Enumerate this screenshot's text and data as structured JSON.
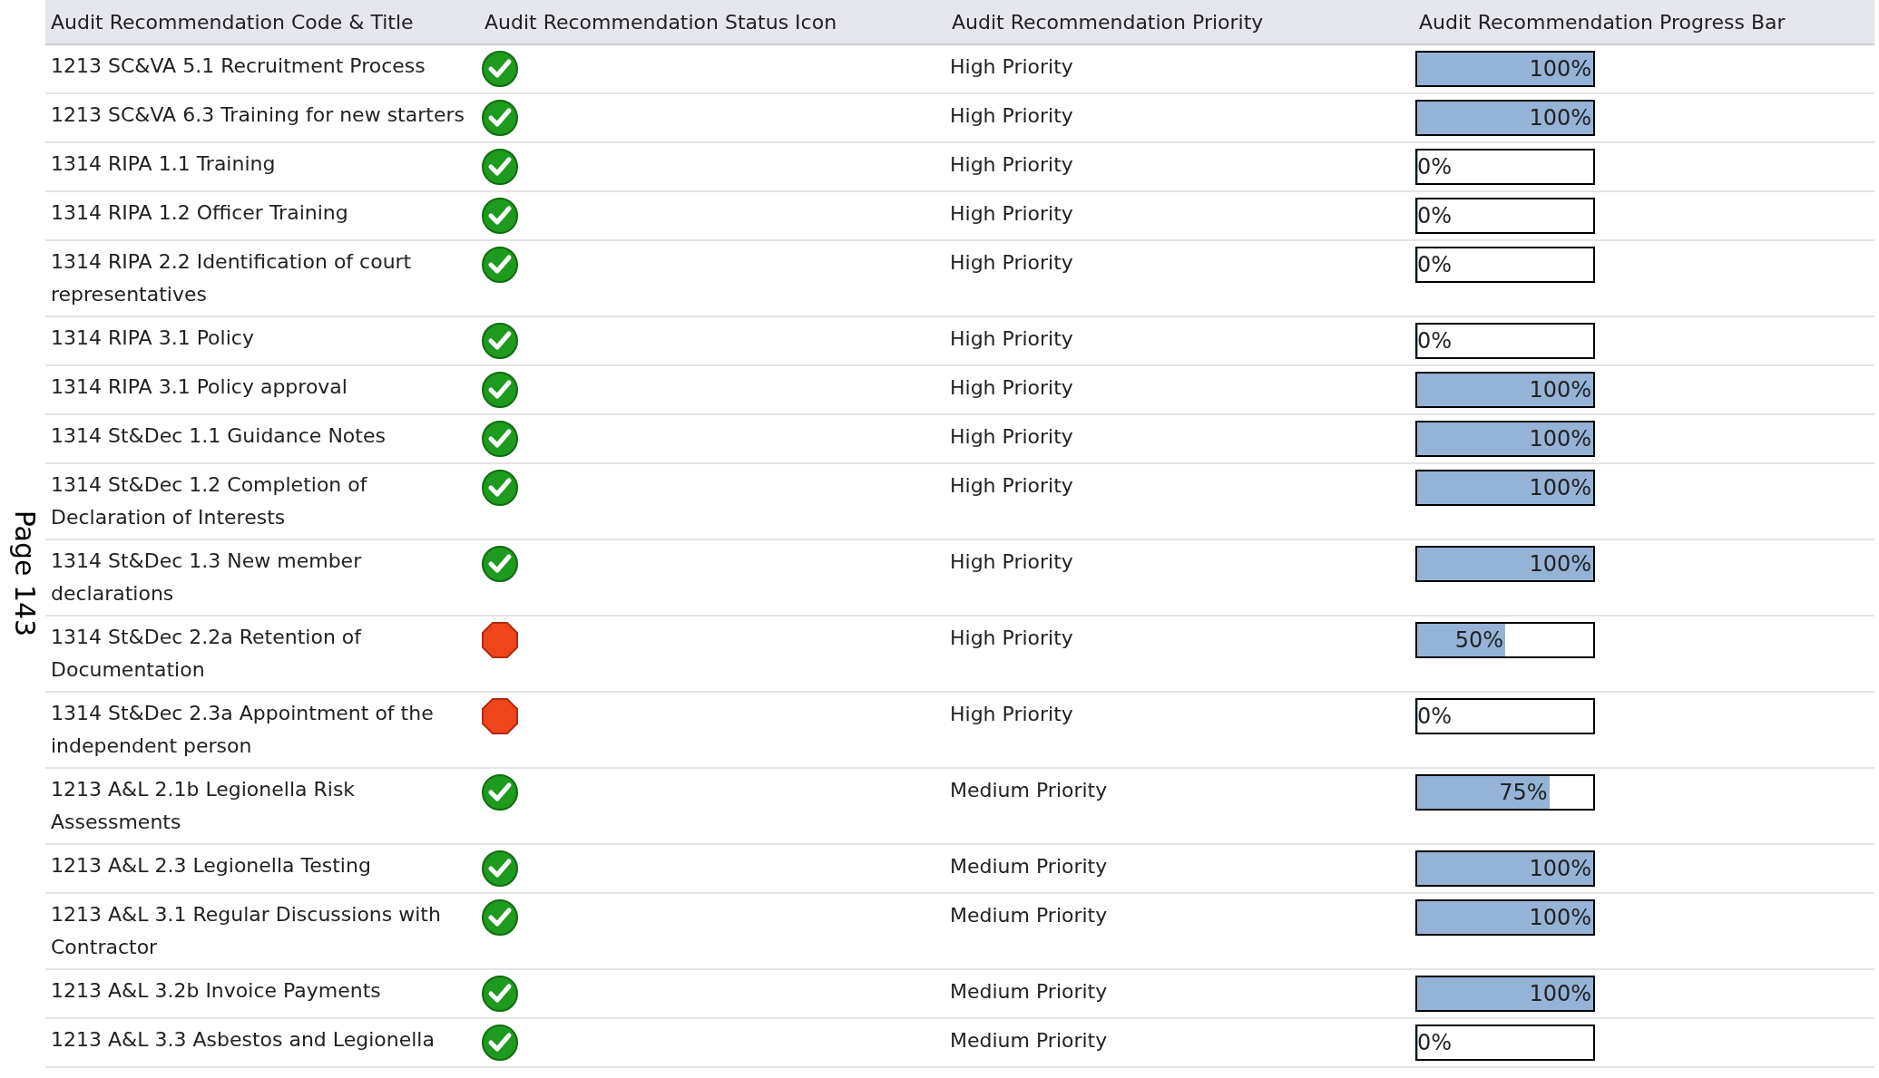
{
  "page_label": "Page 143",
  "table": {
    "columns": [
      "Audit Recommendation Code & Title",
      "Audit Recommendation Status Icon",
      "Audit Recommendation Priority",
      "Audit Recommendation Progress Bar"
    ],
    "rows": [
      {
        "title": "1213 SC&VA 5.1 Recruitment Process",
        "kind": "complete",
        "priority": "High Priority",
        "level": 1,
        "progress": "100%"
      },
      {
        "title": "1213 SC&VA 6.3 Training for new starters",
        "kind": "complete",
        "priority": "High Priority",
        "level": 1,
        "progress": "100%"
      },
      {
        "title": "1314 RIPA 1.1 Training",
        "kind": "complete",
        "priority": "High Priority",
        "level": 0,
        "progress": "0%"
      },
      {
        "title": "1314 RIPA 1.2 Officer Training",
        "kind": "complete",
        "priority": "High Priority",
        "level": 0,
        "progress": "0%"
      },
      {
        "title": "1314 RIPA 2.2 Identification of court representatives",
        "kind": "complete",
        "priority": "High Priority",
        "level": 0,
        "progress": "0%"
      },
      {
        "title": "1314 RIPA 3.1 Policy",
        "kind": "complete",
        "priority": "High Priority",
        "level": 0,
        "progress": "0%"
      },
      {
        "title": "1314 RIPA 3.1 Policy approval",
        "kind": "complete",
        "priority": "High Priority",
        "level": 1,
        "progress": "100%"
      },
      {
        "title": "1314 St&Dec 1.1 Guidance Notes",
        "kind": "complete",
        "priority": "High Priority",
        "level": 1,
        "progress": "100%"
      },
      {
        "title": "1314 St&Dec 1.2 Completion of Declaration of Interests",
        "kind": "complete",
        "priority": "High Priority",
        "level": 1,
        "progress": "100%"
      },
      {
        "title": "1314 St&Dec 1.3 New member declarations",
        "kind": "complete",
        "priority": "High Priority",
        "level": 1,
        "progress": "100%"
      },
      {
        "title": "1314 St&Dec 2.2a Retention of Documentation",
        "kind": "stopped",
        "priority": "High Priority",
        "level": 0.5,
        "progress": "50%"
      },
      {
        "title": "1314 St&Dec 2.3a Appointment of the independent person",
        "kind": "stopped",
        "priority": "High Priority",
        "level": 0,
        "progress": "0%"
      },
      {
        "title": "1213 A&L 2.1b Legionella Risk Assessments",
        "kind": "complete",
        "priority": "Medium Priority",
        "level": 0.75,
        "progress": "75%"
      },
      {
        "title": "1213 A&L 2.3 Legionella Testing",
        "kind": "complete",
        "priority": "Medium Priority",
        "level": 1,
        "progress": "100%"
      },
      {
        "title": "1213 A&L 3.1 Regular Discussions with Contractor",
        "kind": "complete",
        "priority": "Medium Priority",
        "level": 1,
        "progress": "100%"
      },
      {
        "title": "1213 A&L 3.2b Invoice Payments",
        "kind": "complete",
        "priority": "Medium Priority",
        "level": 1,
        "progress": "100%"
      },
      {
        "title": "1213 A&L 3.3 Asbestos and Legionella",
        "kind": "complete",
        "priority": "Medium Priority",
        "level": 0,
        "progress": "0%"
      }
    ]
  }
}
